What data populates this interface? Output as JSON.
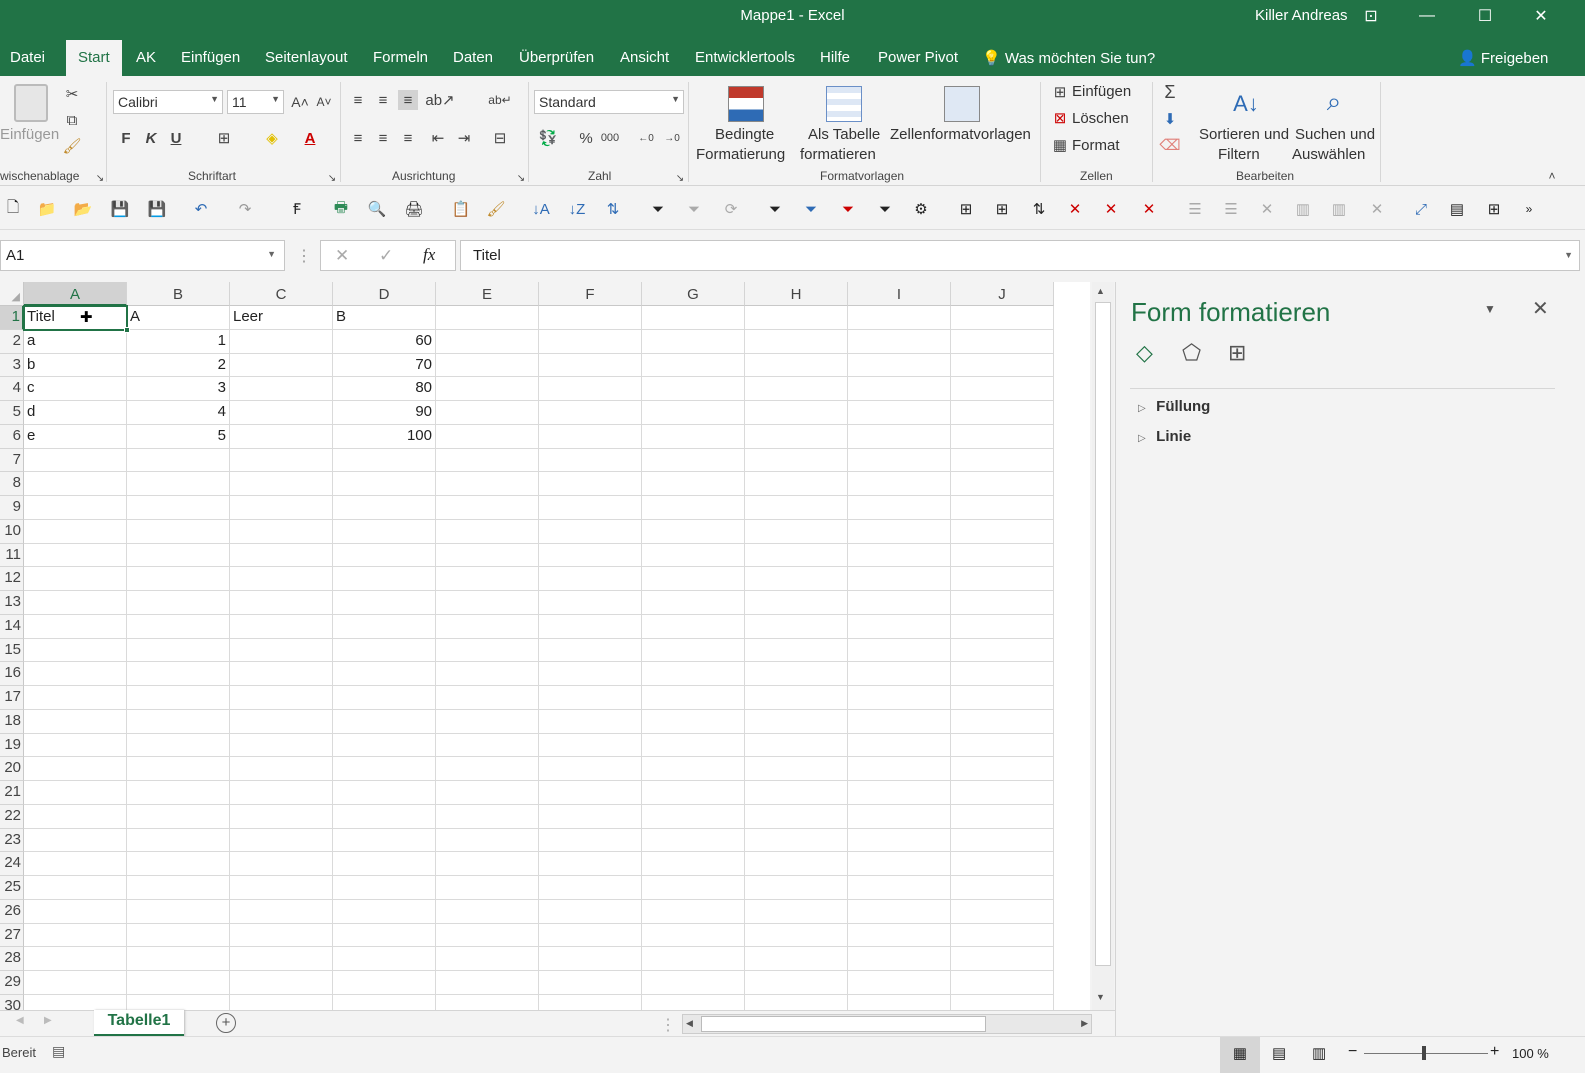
{
  "window": {
    "title": "Mappe1  -  Excel",
    "user": "Killer Andreas",
    "controls": {
      "ribbon_options": "⊡",
      "minimize": "—",
      "maximize": "☐",
      "close": "✕"
    }
  },
  "tabs": [
    {
      "label": "Datei"
    },
    {
      "label": "Start"
    },
    {
      "label": "AK"
    },
    {
      "label": "Einfügen"
    },
    {
      "label": "Seitenlayout"
    },
    {
      "label": "Formeln"
    },
    {
      "label": "Daten"
    },
    {
      "label": "Überprüfen"
    },
    {
      "label": "Ansicht"
    },
    {
      "label": "Entwicklertools"
    },
    {
      "label": "Hilfe"
    },
    {
      "label": "Power Pivot"
    }
  ],
  "active_tab": "Start",
  "tell_me": "Was möchten Sie tun?",
  "share": "Freigeben",
  "ribbon": {
    "clipboard": {
      "paste": "Einfügen",
      "group": "wischenablage"
    },
    "font": {
      "name": "Calibri",
      "size": "11",
      "bold": "F",
      "italic": "K",
      "underline": "U",
      "group": "Schriftart"
    },
    "alignment": {
      "group": "Ausrichtung"
    },
    "number": {
      "format": "Standard",
      "percent": "%",
      "thousands": "000",
      "group": "Zahl"
    },
    "styles": {
      "conditional_1": "Bedingte",
      "conditional_2": "Formatierung",
      "table_1": "Als Tabelle",
      "table_2": "formatieren",
      "cellstyles": "Zellenformatvorlagen",
      "group": "Formatvorlagen"
    },
    "cells": {
      "insert": "Einfügen",
      "delete": "Löschen",
      "format": "Format",
      "group": "Zellen"
    },
    "editing": {
      "sort_1": "Sortieren und",
      "sort_2": "Filtern",
      "find_1": "Suchen und",
      "find_2": "Auswählen",
      "group": "Bearbeiten"
    }
  },
  "formula_bar": {
    "name_box": "A1",
    "content": "Titel",
    "fx": "fx"
  },
  "columns": [
    "A",
    "B",
    "C",
    "D",
    "E",
    "F",
    "G",
    "H",
    "I",
    "J"
  ],
  "rows": [
    "1",
    "2",
    "3",
    "4",
    "5",
    "6",
    "7",
    "8",
    "9",
    "10",
    "11",
    "12",
    "13",
    "14",
    "15",
    "16",
    "17",
    "18",
    "19",
    "20",
    "21",
    "22",
    "23",
    "24",
    "25",
    "26",
    "27",
    "28",
    "29",
    "30"
  ],
  "cells": [
    {
      "ref": "A1",
      "value": "Titel"
    },
    {
      "ref": "B1",
      "value": "A"
    },
    {
      "ref": "C1",
      "value": "Leer"
    },
    {
      "ref": "D1",
      "value": "B"
    },
    {
      "ref": "A2",
      "value": "a"
    },
    {
      "ref": "B2",
      "value": "1",
      "num": true
    },
    {
      "ref": "D2",
      "value": "60",
      "num": true
    },
    {
      "ref": "A3",
      "value": "b"
    },
    {
      "ref": "B3",
      "value": "2",
      "num": true
    },
    {
      "ref": "D3",
      "value": "70",
      "num": true
    },
    {
      "ref": "A4",
      "value": "c"
    },
    {
      "ref": "B4",
      "value": "3",
      "num": true
    },
    {
      "ref": "D4",
      "value": "80",
      "num": true
    },
    {
      "ref": "A5",
      "value": "d"
    },
    {
      "ref": "B5",
      "value": "4",
      "num": true
    },
    {
      "ref": "D5",
      "value": "90",
      "num": true
    },
    {
      "ref": "A6",
      "value": "e"
    },
    {
      "ref": "B6",
      "value": "5",
      "num": true
    },
    {
      "ref": "D6",
      "value": "100",
      "num": true
    }
  ],
  "selected_cell": "A1",
  "sheet_tabs": [
    {
      "label": "Tabelle1"
    }
  ],
  "format_pane": {
    "title": "Form formatieren",
    "sections": [
      "Füllung",
      "Linie"
    ]
  },
  "status": {
    "text": "Bereit",
    "zoom": "100 %"
  },
  "colors": {
    "accent": "#217346"
  }
}
